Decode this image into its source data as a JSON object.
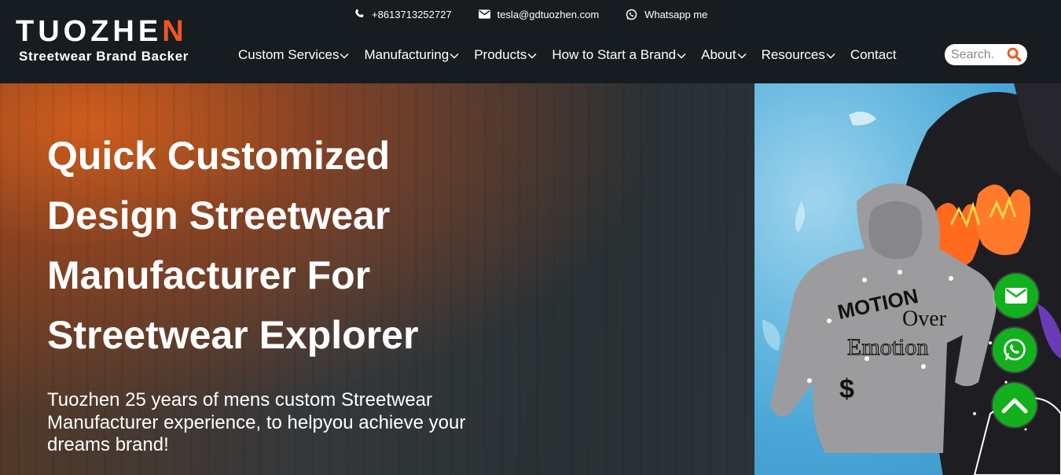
{
  "logo": {
    "word_part1": "TUOZHE",
    "word_part2": "N",
    "tagline": "Streetwear Brand Backer"
  },
  "topbar": {
    "phone": "+8613713252727",
    "email": "tesla@gdtuozhen.com",
    "whatsapp": "Whatsapp me"
  },
  "nav": {
    "items": [
      {
        "label": "Custom Services",
        "dropdown": true
      },
      {
        "label": "Manufacturing",
        "dropdown": true
      },
      {
        "label": "Products",
        "dropdown": true
      },
      {
        "label": "How to Start a Brand",
        "dropdown": true
      },
      {
        "label": "About",
        "dropdown": true
      },
      {
        "label": "Resources",
        "dropdown": true
      },
      {
        "label": "Contact",
        "dropdown": false
      }
    ]
  },
  "search": {
    "placeholder": "Search."
  },
  "hero": {
    "title_lines": [
      "Quick Customized",
      "Design Streetwear",
      "Manufacturer For",
      "Streetwear Explorer"
    ],
    "subtitle": "Tuozhen 25 years of mens custom Streetwear Manufacturer experience, to helpyou achieve your dreams brand!",
    "image_text": {
      "hoodie_line1": "MOTION",
      "hoodie_line2": "Over",
      "hoodie_line3": "Emotion"
    }
  },
  "floating_buttons": {
    "mail": "envelope-icon",
    "whatsapp": "whatsapp-icon",
    "scroll_top": "chevron-up-icon"
  },
  "colors": {
    "header_bg": "#171c21",
    "brand_orange": "#f0561d",
    "fab_green": "#12b01d",
    "search_icon": "#f0561d"
  }
}
